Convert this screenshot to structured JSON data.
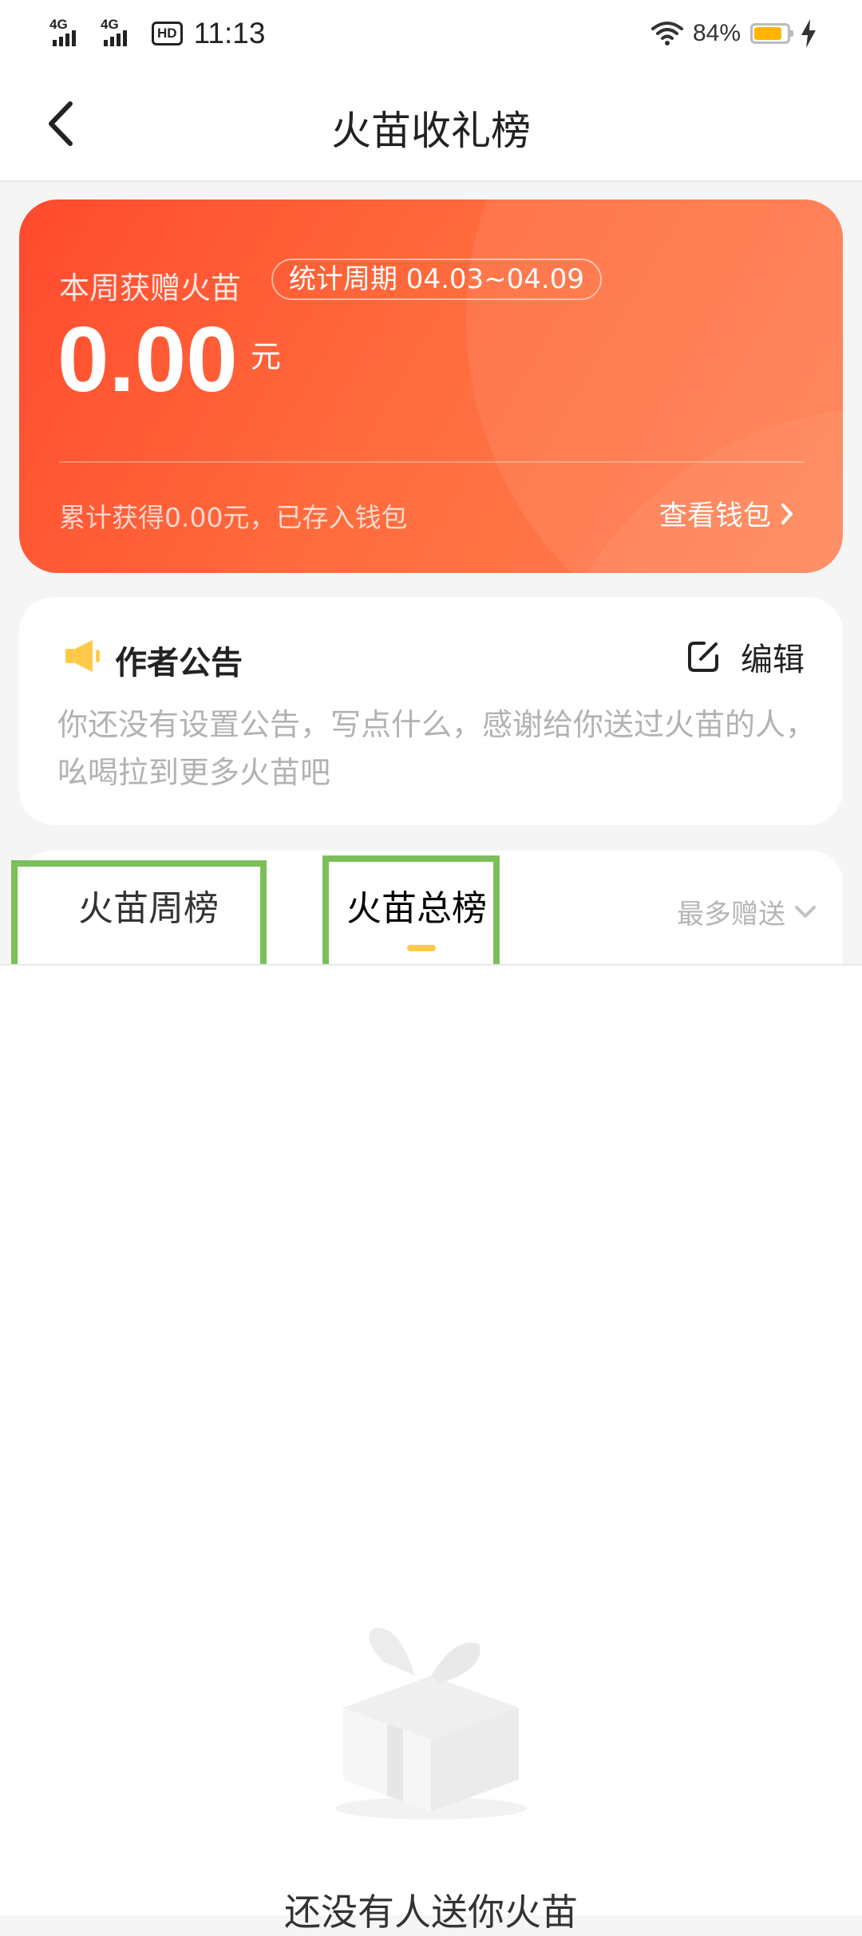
{
  "status_bar": {
    "signal1_tag": "4G",
    "signal2_tag": "4G",
    "hd_tag": "HD",
    "time": "11:13",
    "battery_percent": "84%",
    "battery_level": 0.84
  },
  "nav": {
    "title": "火苗收礼榜"
  },
  "earn_card": {
    "week_label": "本周获赠火苗",
    "period": "统计周期 04.03~04.09",
    "amount": "0.00",
    "unit": "元",
    "total_text": "累计获得0.00元，已存入钱包",
    "wallet_label": "查看钱包"
  },
  "notice": {
    "title": "作者公告",
    "edit_label": "编辑",
    "content": "你还没有设置公告，写点什么，感谢给你送过火苗的人，吆喝拉到更多火苗吧"
  },
  "tabs": {
    "items": [
      {
        "label": "火苗周榜"
      },
      {
        "label": "火苗总榜"
      }
    ],
    "selected": "火苗总榜",
    "sort_label": "最多赠送"
  },
  "empty": {
    "text": "还没有人送你火苗"
  },
  "colors": {
    "card_start": "#ff4a2e",
    "card_end": "#ff8052",
    "indicator": "#ffc94a",
    "notice_icon": "#ffc94a",
    "highlight": "#7bbf5a"
  }
}
